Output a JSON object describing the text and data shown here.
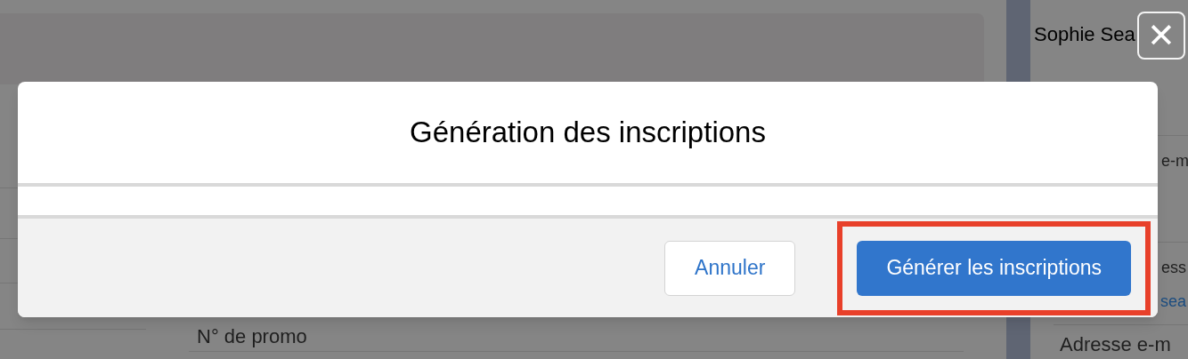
{
  "background": {
    "main": {
      "field_label": "N° de promo"
    },
    "side_panel": {
      "name_value": "Sophie Sea",
      "label_fragment_1": "e-m",
      "label_fragment_2": "ess",
      "link_fragment": "sea",
      "label_3": "Adresse e-m"
    }
  },
  "close_button": {
    "label": "✕"
  },
  "modal": {
    "title": "Génération des inscriptions",
    "buttons": [
      {
        "label": "Annuler",
        "kind": "neutral",
        "highlighted": false
      },
      {
        "label": "Générer les inscriptions",
        "kind": "brand",
        "highlighted": true
      }
    ]
  }
}
